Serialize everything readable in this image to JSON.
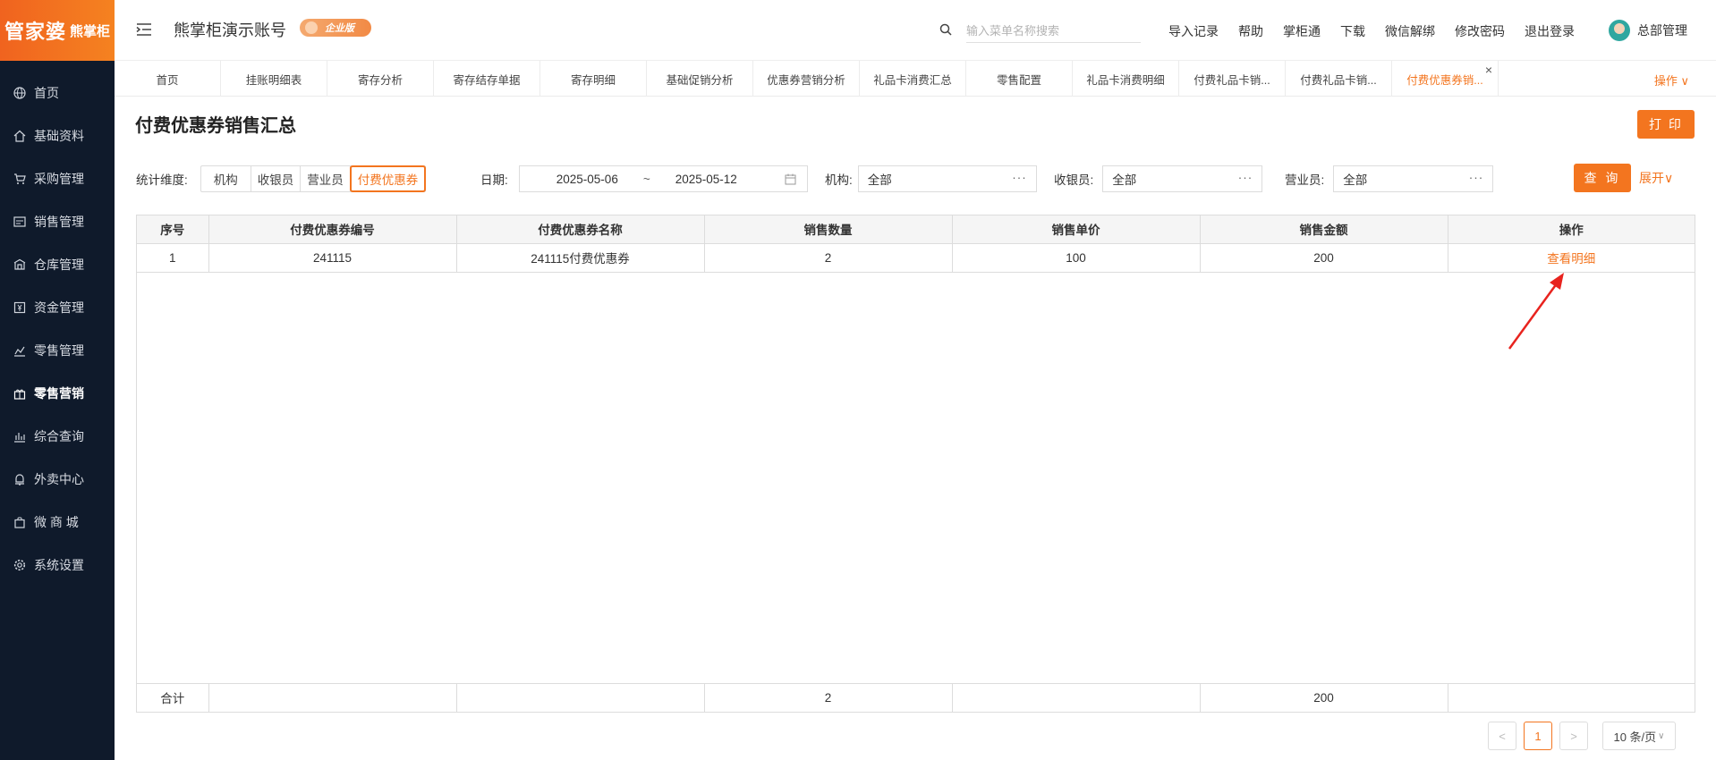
{
  "brand": {
    "logo_main": "管家婆",
    "logo_sub": "熊掌柜"
  },
  "sidebar": {
    "items": [
      {
        "label": "首页",
        "icon": "globe-icon"
      },
      {
        "label": "基础资料",
        "icon": "home-icon"
      },
      {
        "label": "采购管理",
        "icon": "cart-icon"
      },
      {
        "label": "销售管理",
        "icon": "sales-icon"
      },
      {
        "label": "仓库管理",
        "icon": "warehouse-icon"
      },
      {
        "label": "资金管理",
        "icon": "money-icon"
      },
      {
        "label": "零售管理",
        "icon": "chart-icon"
      },
      {
        "label": "零售营销",
        "icon": "gift-icon",
        "active": true
      },
      {
        "label": "综合查询",
        "icon": "bar-chart-icon"
      },
      {
        "label": "外卖中心",
        "icon": "bell-icon"
      },
      {
        "label": "微 商 城",
        "icon": "bag-icon"
      },
      {
        "label": "系统设置",
        "icon": "gear-icon"
      }
    ]
  },
  "header": {
    "account": "熊掌柜演示账号",
    "edition_badge": "企业版",
    "search_placeholder": "输入菜单名称搜索",
    "links": [
      "导入记录",
      "帮助",
      "掌柜通",
      "下载",
      "微信解绑",
      "修改密码",
      "退出登录"
    ],
    "user": "总部管理"
  },
  "tabs": {
    "items": [
      "首页",
      "挂账明细表",
      "寄存分析",
      "寄存结存单据",
      "寄存明细",
      "基础促销分析",
      "优惠券营销分析",
      "礼品卡消费汇总",
      "零售配置",
      "礼品卡消费明细",
      "付费礼品卡销...",
      "付费礼品卡销...",
      "付费优惠券销..."
    ],
    "active_index": 12,
    "ops_label": "操作 ∨"
  },
  "page": {
    "title": "付费优惠券销售汇总",
    "print_label": "打 印"
  },
  "filters": {
    "dimension_label": "统计维度:",
    "dimension_options": [
      "机构",
      "收银员",
      "营业员",
      "付费优惠券"
    ],
    "dimension_selected": "付费优惠券",
    "date_label": "日期:",
    "date_from": "2025-05-06",
    "date_sep": "~",
    "date_to": "2025-05-12",
    "org_label": "机构:",
    "org_value": "全部",
    "cashier_label": "收银员:",
    "cashier_value": "全部",
    "clerk_label": "营业员:",
    "clerk_value": "全部",
    "query_label": "查 询",
    "expand_label": "展开∨"
  },
  "table": {
    "columns": [
      "序号",
      "付费优惠券编号",
      "付费优惠券名称",
      "销售数量",
      "销售单价",
      "销售金额",
      "操作"
    ],
    "rows": [
      {
        "no": "1",
        "code": "241115",
        "name": "241115付费优惠券",
        "qty": "2",
        "price": "100",
        "amount": "200",
        "action": "查看明细"
      }
    ],
    "total": {
      "label": "合计",
      "qty": "2",
      "amount": "200"
    }
  },
  "pagination": {
    "current": "1",
    "prev": "<",
    "next": ">",
    "page_size": "10 条/页"
  },
  "colors": {
    "accent": "#f3751f",
    "sidebar_bg": "#0f1a2b"
  }
}
